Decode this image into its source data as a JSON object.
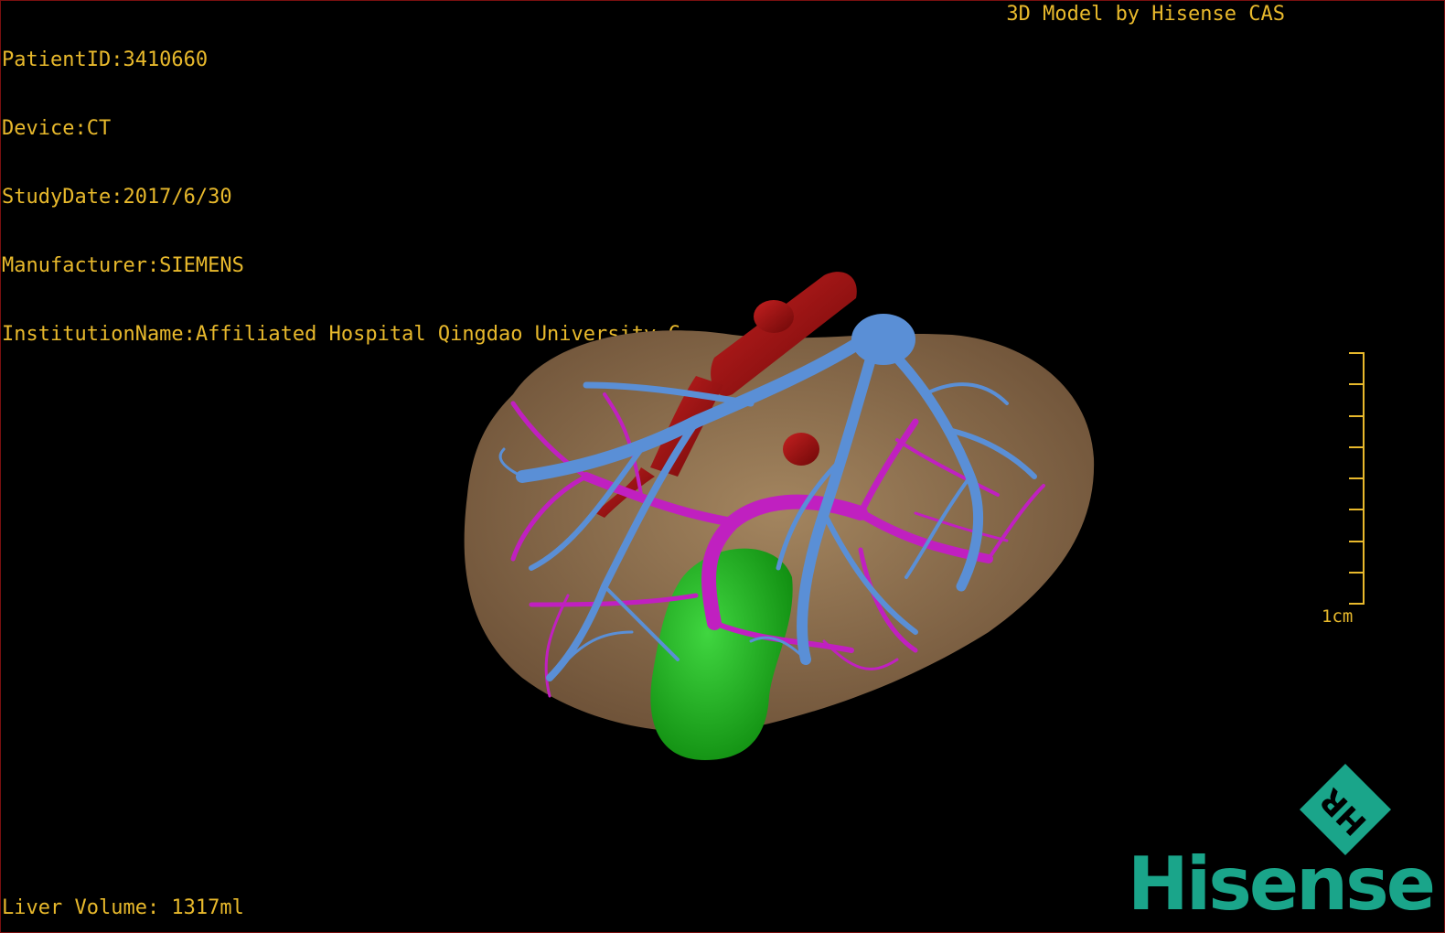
{
  "overlay": {
    "patient_id": "PatientID:3410660",
    "device": "Device:CT",
    "study_date": "StudyDate:2017/6/30",
    "manufacturer": "Manufacturer:SIEMENS",
    "institution": "InstitutionName:Affiliated Hospital Qingdao University-C",
    "title": "3D Model by Hisense CAS",
    "liver_volume": "Liver Volume: 1317ml"
  },
  "scale": {
    "label": "1cm",
    "ticks": 8
  },
  "logo": {
    "badge_text": "HR",
    "brand": "Hisense",
    "color": "#1aa58a"
  },
  "colors": {
    "text": "#e8b92c",
    "liver": "#8a6b4a",
    "hepatic_vein": "#5a8fd6",
    "portal_vein": "#c020c0",
    "ivc": "#a01010",
    "gallbladder": "#18b418",
    "border": "#7a1010"
  }
}
